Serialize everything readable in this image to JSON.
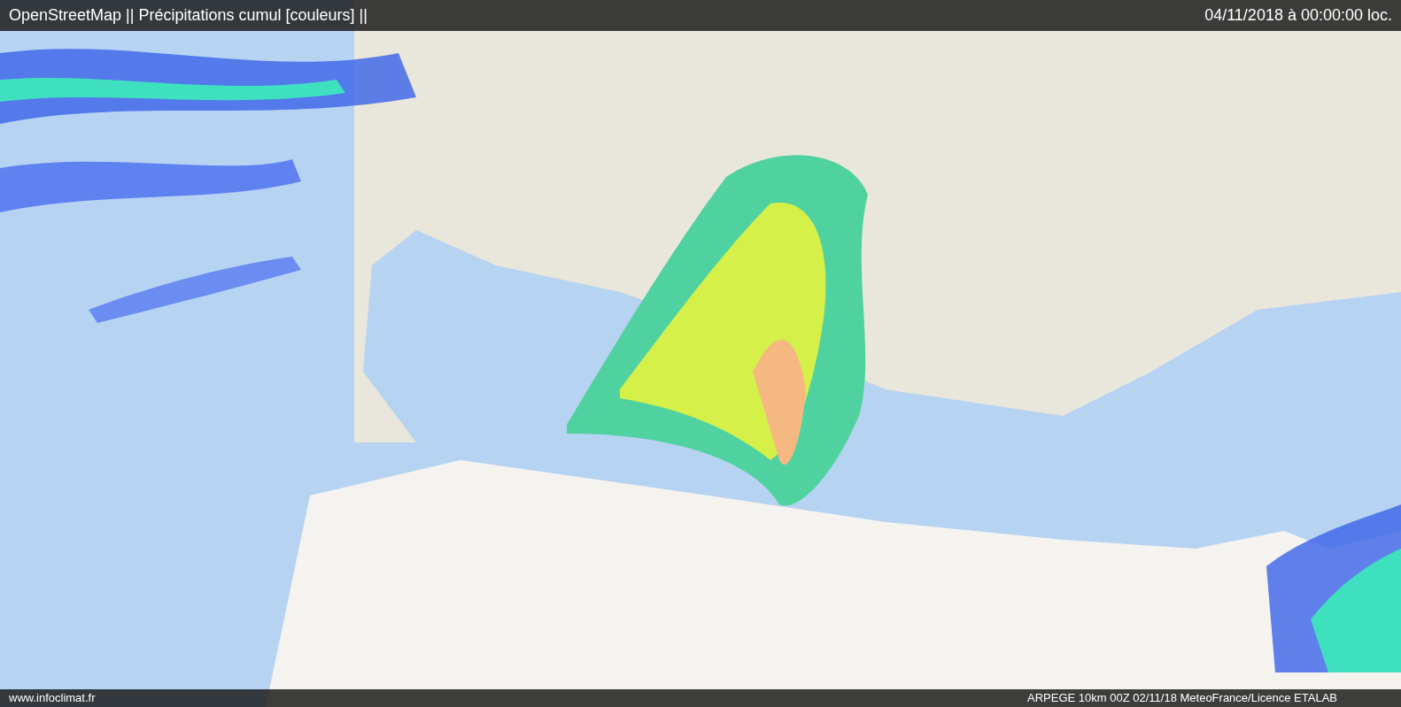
{
  "header": {
    "title": "OpenStreetMap || Précipitations cumul [couleurs] ||",
    "datetime": "04/11/2018 à 00:00:00 loc."
  },
  "footer": {
    "site": "www.infoclimat.fr",
    "credit": "ARPEGE 10km 00Z 02/11/18 MeteoFrance/Licence ETALAB"
  }
}
